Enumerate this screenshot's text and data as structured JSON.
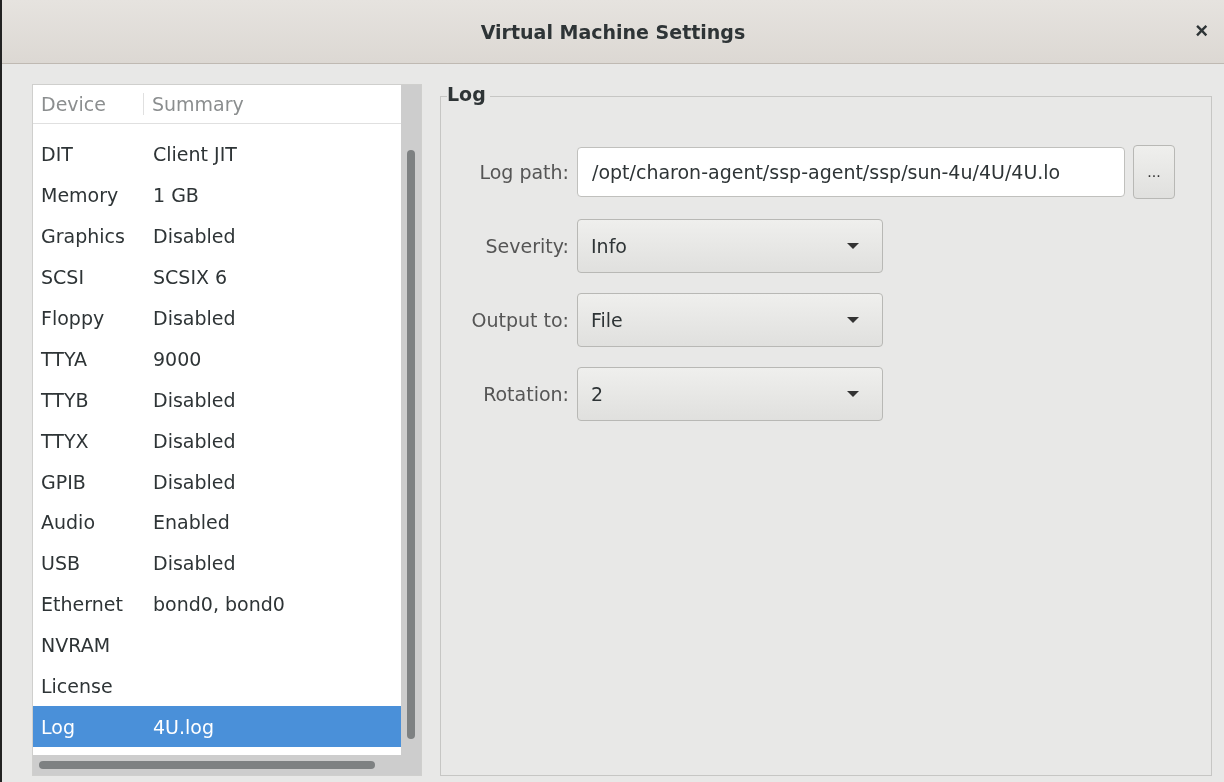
{
  "window": {
    "title": "Virtual Machine Settings",
    "close": "×"
  },
  "device_list": {
    "columns": [
      "Device",
      "Summary"
    ],
    "rows": [
      {
        "device": "DIT",
        "summary": "Client JIT",
        "selected": false
      },
      {
        "device": "Memory",
        "summary": "1 GB",
        "selected": false
      },
      {
        "device": "Graphics",
        "summary": "Disabled",
        "selected": false
      },
      {
        "device": "SCSI",
        "summary": "SCSIX 6",
        "selected": false
      },
      {
        "device": "Floppy",
        "summary": "Disabled",
        "selected": false
      },
      {
        "device": "TTYA",
        "summary": "9000",
        "selected": false
      },
      {
        "device": "TTYB",
        "summary": "Disabled",
        "selected": false
      },
      {
        "device": "TTYX",
        "summary": "Disabled",
        "selected": false
      },
      {
        "device": "GPIB",
        "summary": "Disabled",
        "selected": false
      },
      {
        "device": "Audio",
        "summary": "Enabled",
        "selected": false
      },
      {
        "device": "USB",
        "summary": "Disabled",
        "selected": false
      },
      {
        "device": "Ethernet",
        "summary": "bond0, bond0",
        "selected": false
      },
      {
        "device": "NVRAM",
        "summary": "",
        "selected": false
      },
      {
        "device": "License",
        "summary": "",
        "selected": false
      },
      {
        "device": "Log",
        "summary": "4U.log",
        "selected": true
      }
    ]
  },
  "log_group": {
    "title": "Log",
    "log_path": {
      "label": "Log path:",
      "value": "/opt/charon-agent/ssp-agent/ssp/sun-4u/4U/4U.lo",
      "browse": "..."
    },
    "dropdowns": [
      {
        "label": "Severity:",
        "value": "Info"
      },
      {
        "label": "Output to:",
        "value": "File"
      },
      {
        "label": "Rotation:",
        "value": "2"
      }
    ]
  }
}
